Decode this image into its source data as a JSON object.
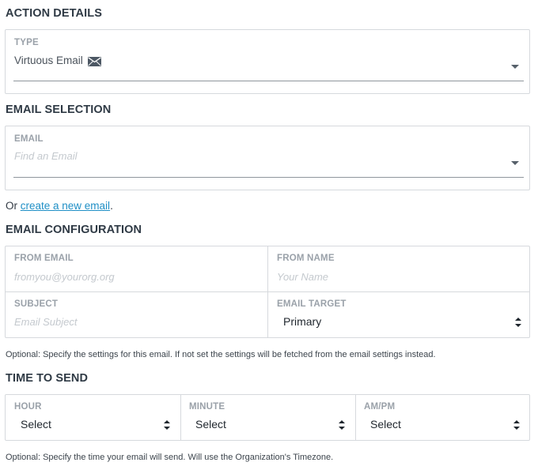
{
  "action_details": {
    "heading": "ACTION DETAILS",
    "type_label": "TYPE",
    "type_value": "Virtuous Email",
    "type_icon": "envelope-icon"
  },
  "email_selection": {
    "heading": "EMAIL SELECTION",
    "email_label": "EMAIL",
    "email_placeholder": "Find an Email",
    "or_prefix": "Or ",
    "create_link": "create a new email",
    "or_suffix": "."
  },
  "email_configuration": {
    "heading": "EMAIL CONFIGURATION",
    "from_email_label": "FROM EMAIL",
    "from_email_placeholder": "fromyou@yourorg.org",
    "from_name_label": "FROM NAME",
    "from_name_placeholder": "Your Name",
    "subject_label": "SUBJECT",
    "subject_placeholder": "Email Subject",
    "email_target_label": "EMAIL TARGET",
    "email_target_value": "Primary",
    "help": "Optional: Specify the settings for this email. If not set the settings will be fetched from the email settings instead."
  },
  "time_to_send": {
    "heading": "TIME TO SEND",
    "hour_label": "HOUR",
    "hour_value": "Select",
    "minute_label": "MINUTE",
    "minute_value": "Select",
    "ampm_label": "AM/PM",
    "ampm_value": "Select",
    "help": "Optional: Specify the time your email will send. Will use the Organization's Timezone."
  },
  "colors": {
    "link": "#1f8fc6",
    "heading": "#2f3a45",
    "border": "#d6d9dd",
    "label": "#9aa1a9",
    "placeholder": "#c4c9ce"
  }
}
